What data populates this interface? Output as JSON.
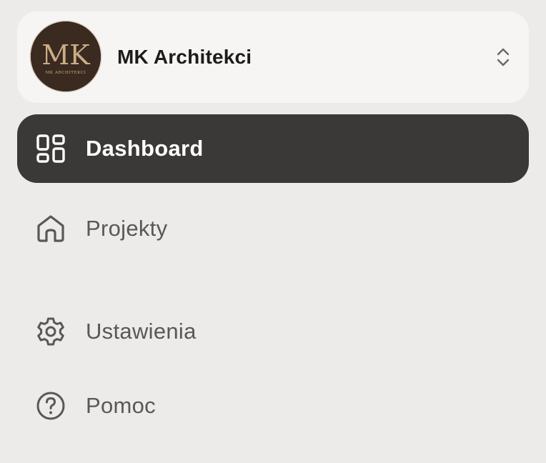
{
  "workspace": {
    "name": "MK Architekci",
    "logo_monogram": "MK",
    "logo_caption": "MK ARCHITEKCI",
    "switcher_icon": "chevron-up-down-icon"
  },
  "nav": {
    "items": [
      {
        "label": "Dashboard",
        "icon": "dashboard-grid-icon",
        "active": true
      },
      {
        "label": "Projekty",
        "icon": "home-icon",
        "active": false
      },
      {
        "label": "Ustawienia",
        "icon": "gear-icon",
        "active": false
      },
      {
        "label": "Pomoc",
        "icon": "help-circle-icon",
        "active": false
      }
    ]
  },
  "colors": {
    "background": "#edebe9",
    "card": "#f6f5f3",
    "active_item": "#3a3937",
    "logo_bg": "#3a2a20",
    "logo_gold": "#c9ad85",
    "muted_text": "#5a5856"
  }
}
